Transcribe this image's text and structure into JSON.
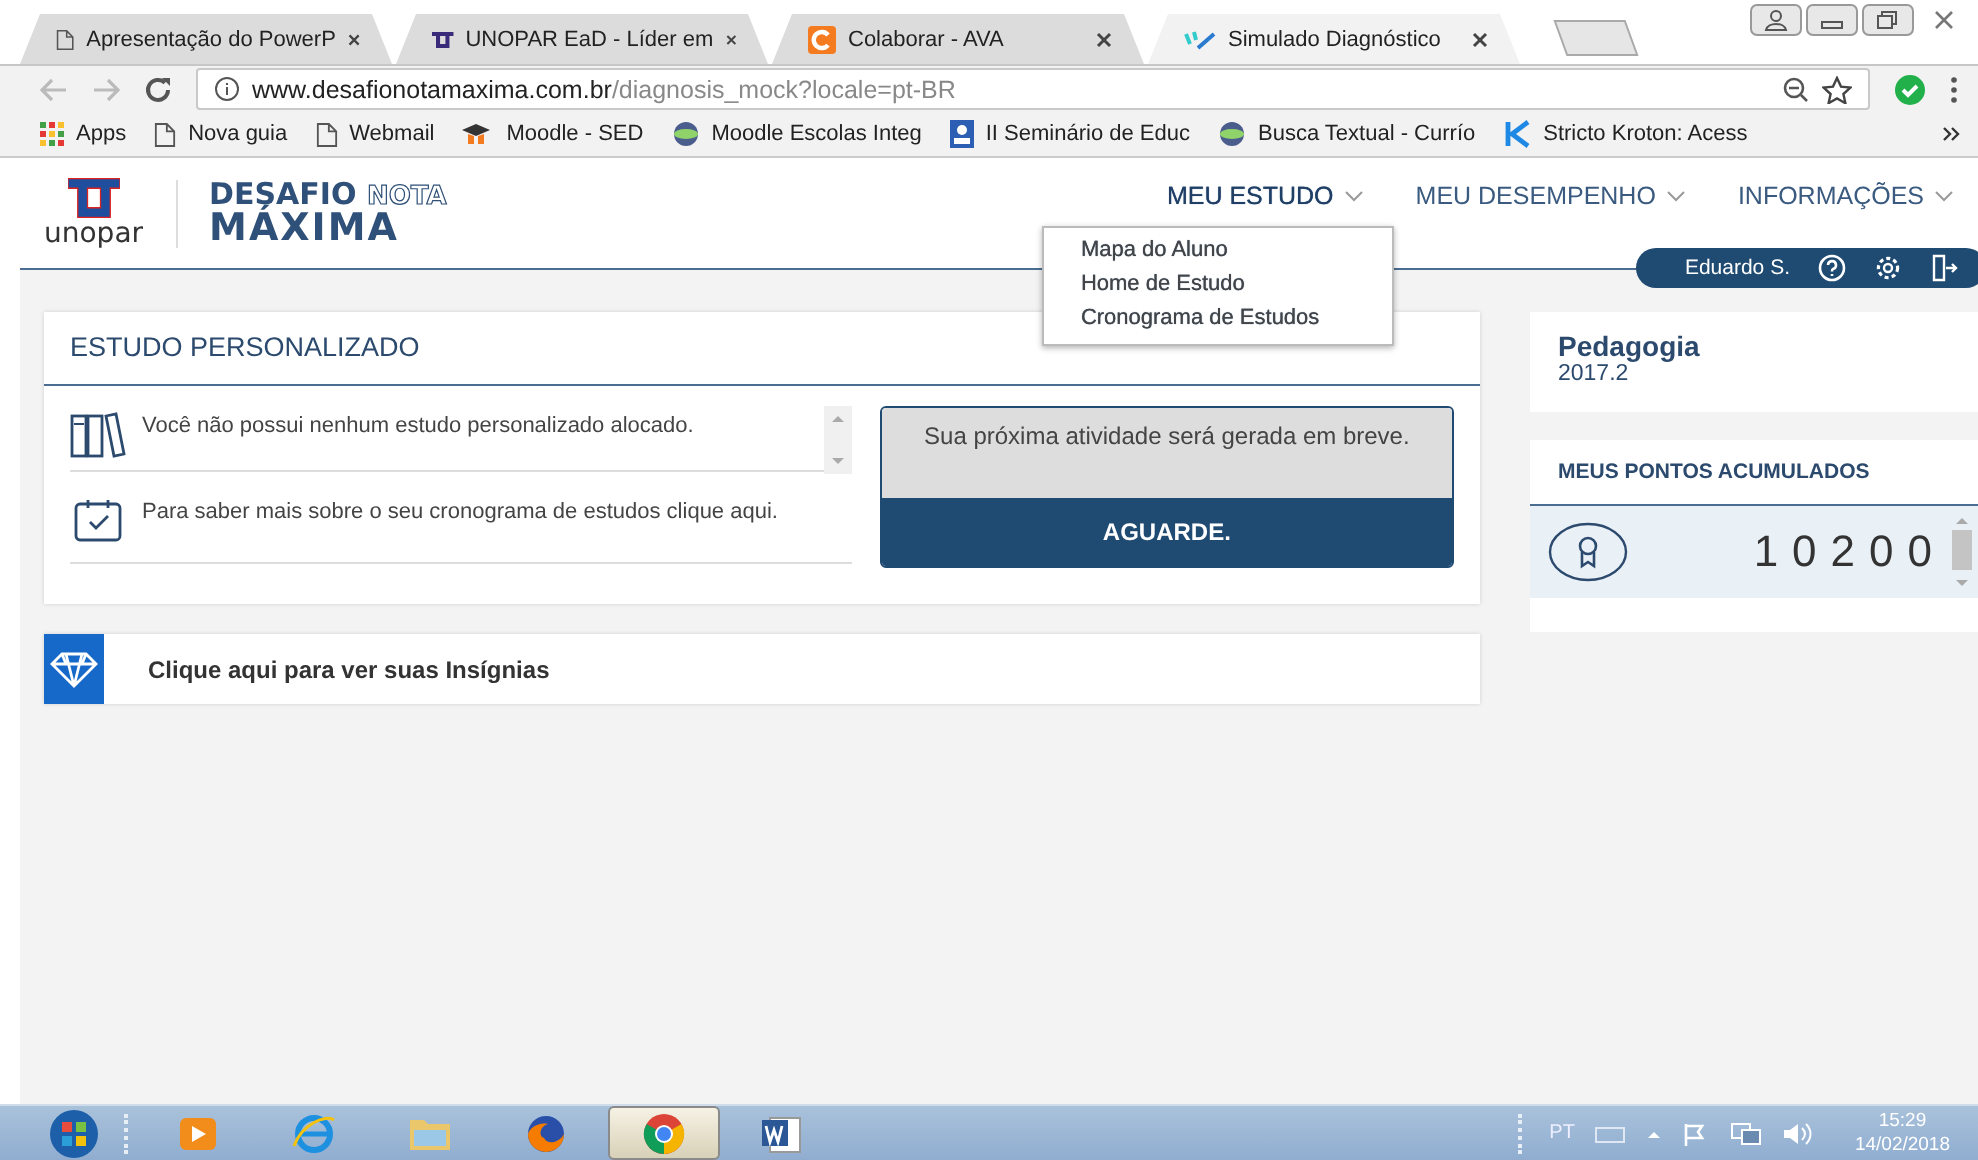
{
  "browser": {
    "tabs": [
      {
        "title": "Apresentação do PowerP",
        "kind": "page",
        "selected": false
      },
      {
        "title": "UNOPAR EaD - Líder em",
        "kind": "unopar",
        "selected": false
      },
      {
        "title": "Colaborar - AVA",
        "kind": "colaborar",
        "selected": false
      },
      {
        "title": "Simulado Diagnóstico",
        "kind": "simulado",
        "selected": true
      }
    ],
    "url": {
      "domain": "www.desafionotamaxima.com.br",
      "path": "/diagnosis_mock?locale=pt-BR"
    },
    "bookmarks": [
      {
        "label": "Apps",
        "kind": "apps"
      },
      {
        "label": "Nova guia",
        "kind": "page"
      },
      {
        "label": "Webmail",
        "kind": "page"
      },
      {
        "label": "Moodle - SED",
        "kind": "moodle"
      },
      {
        "label": "Moodle Escolas Integ",
        "kind": "globe"
      },
      {
        "label": "II Seminário de Educ",
        "kind": "seminar"
      },
      {
        "label": "Busca Textual - Currío",
        "kind": "globe"
      },
      {
        "label": "Stricto Kroton: Acess",
        "kind": "kroton"
      }
    ]
  },
  "header": {
    "logo": {
      "wordmark": "unopar",
      "brand_top": "DESAFIO",
      "brand_outline": "NOTA",
      "brand_bottom": "MÁXIMA"
    },
    "nav": [
      {
        "label": "MEU ESTUDO",
        "expanded": true
      },
      {
        "label": "MEU DESEMPENHO",
        "expanded": false
      },
      {
        "label": "INFORMAÇÕES",
        "expanded": false
      }
    ],
    "dropdown": [
      "Mapa do Aluno",
      "Home de Estudo",
      "Cronograma de Estudos"
    ],
    "user": "Eduardo S."
  },
  "study_card": {
    "title": "ESTUDO PERSONALIZADO",
    "items": [
      {
        "kind": "books",
        "text": "Você não possui nenhum estudo personalizado alocado."
      },
      {
        "kind": "calendar",
        "text": "Para saber mais sobre o seu cronograma de estudos clique aqui."
      }
    ],
    "next_activity": {
      "message": "Sua próxima atividade será gerada em breve.",
      "button": "AGUARDE."
    }
  },
  "badges_link": "Clique aqui para ver suas Insígnias",
  "course": {
    "name": "Pedagogia",
    "term": "2017.2"
  },
  "points": {
    "title": "MEUS PONTOS ACUMULADOS",
    "value": "10200"
  },
  "taskbar": {
    "apps": [
      {
        "kind": "media",
        "selected": false
      },
      {
        "kind": "ie",
        "selected": false
      },
      {
        "kind": "folder",
        "selected": false
      },
      {
        "kind": "firefox",
        "selected": false
      },
      {
        "kind": "chrome",
        "selected": true
      },
      {
        "kind": "word",
        "selected": false
      }
    ],
    "language": "PT",
    "time": "15:29",
    "date": "14/02/2018"
  }
}
